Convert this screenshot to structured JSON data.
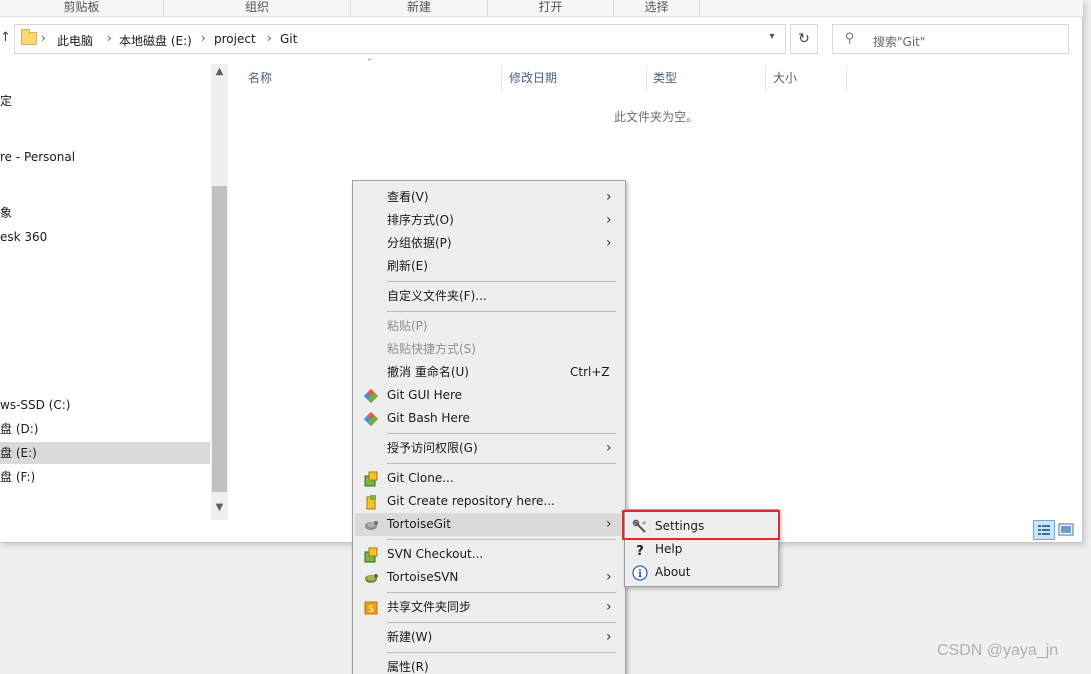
{
  "ribbon": {
    "groups": [
      {
        "label": "剪贴板"
      },
      {
        "label": "组织"
      },
      {
        "label": "新建"
      },
      {
        "label": "打开"
      },
      {
        "label": "选择"
      }
    ]
  },
  "address": {
    "crumbs": [
      "此电脑",
      "本地磁盘 (E:)",
      "project",
      "Git"
    ],
    "search_placeholder": "搜索\"Git\""
  },
  "nav": {
    "items": [
      {
        "label": "定",
        "selected": false
      },
      {
        "label": "re - Personal",
        "selected": false
      },
      {
        "label": "象",
        "selected": false
      },
      {
        "label": "esk 360",
        "selected": false
      },
      {
        "label": "ws-SSD (C:)",
        "selected": false
      },
      {
        "label": "盘 (D:)",
        "selected": false
      },
      {
        "label": "盘 (E:)",
        "selected": true
      },
      {
        "label": "盘 (F:)",
        "selected": false
      }
    ]
  },
  "content": {
    "columns": [
      "名称",
      "修改日期",
      "类型",
      "大小"
    ],
    "empty_message": "此文件夹为空。"
  },
  "context_menu": {
    "items": [
      {
        "label": "查看(V)",
        "submenu": true
      },
      {
        "label": "排序方式(O)",
        "submenu": true
      },
      {
        "label": "分组依据(P)",
        "submenu": true
      },
      {
        "label": "刷新(E)"
      },
      {
        "label": "自定义文件夹(F)..."
      },
      {
        "label": "粘贴(P)",
        "disabled": true
      },
      {
        "label": "粘贴快捷方式(S)",
        "disabled": true
      },
      {
        "label": "撤消 重命名(U)",
        "shortcut": "Ctrl+Z"
      },
      {
        "label": "Git GUI Here",
        "icon": "git-gui-icon"
      },
      {
        "label": "Git Bash Here",
        "icon": "git-bash-icon"
      },
      {
        "label": "授予访问权限(G)",
        "submenu": true
      },
      {
        "label": "Git Clone...",
        "icon": "tortoisegit-clone-icon"
      },
      {
        "label": "Git Create repository here...",
        "icon": "tortoisegit-create-repo-icon"
      },
      {
        "label": "TortoiseGit",
        "icon": "tortoisegit-icon",
        "submenu": true,
        "highlighted": true
      },
      {
        "label": "SVN Checkout...",
        "icon": "svn-checkout-icon"
      },
      {
        "label": "TortoiseSVN",
        "icon": "tortoisesvn-icon",
        "submenu": true
      },
      {
        "label": "共享文件夹同步",
        "icon": "sync-share-icon",
        "submenu": true
      },
      {
        "label": "新建(W)",
        "submenu": true
      },
      {
        "label": "属性(R)"
      }
    ]
  },
  "tortoisegit_submenu": {
    "items": [
      {
        "label": "Settings",
        "icon": "wrench-icon",
        "highlighted_by_annotation": true
      },
      {
        "label": "Help",
        "icon": "help-icon"
      },
      {
        "label": "About",
        "icon": "info-icon"
      }
    ]
  },
  "watermark": "CSDN @yaya_jn",
  "colors": {
    "annotation_red": "#e02b2b",
    "folder_yellow": "#f8d775",
    "menu_bg": "#eeeeee",
    "selected_bg": "#d9d9d9"
  }
}
